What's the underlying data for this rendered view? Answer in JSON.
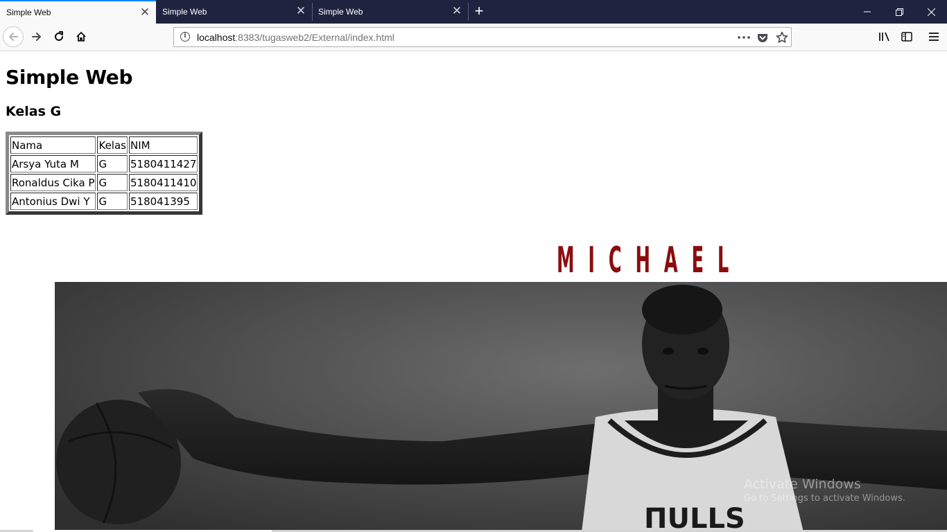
{
  "tabs": [
    {
      "label": "Simple Web",
      "active": true
    },
    {
      "label": "Simple Web",
      "active": false
    },
    {
      "label": "Simple Web",
      "active": false
    }
  ],
  "toolbar": {
    "url_host": "localhost",
    "url_rest": ":8383/tugasweb2/External/index.html"
  },
  "page": {
    "heading": "Simple Web",
    "subheading": "Kelas G",
    "table": {
      "headers": [
        "Nama",
        "Kelas",
        "NIM"
      ],
      "rows": [
        [
          "Arsya Yuta M",
          "G",
          "5180411427"
        ],
        [
          "Ronaldus Cika P",
          "G",
          "5180411410"
        ],
        [
          "Antonius Dwi Y",
          "G",
          "518041395"
        ]
      ]
    },
    "banner_title": "MICHAEL"
  },
  "watermark": {
    "line1": "Activate Windows",
    "line2": "Go to Settings to activate Windows."
  },
  "colors": {
    "tabbar": "#202340",
    "accent": "#0a84ff",
    "banner_title": "#8b0d0d"
  },
  "icons": [
    "back-icon",
    "forward-icon",
    "reload-icon",
    "home-icon",
    "info-icon",
    "more-icon",
    "pocket-icon",
    "star-icon",
    "library-icon",
    "sidebar-icon",
    "menu-icon",
    "close-icon",
    "plus-icon",
    "minimize-icon",
    "restore-icon"
  ]
}
